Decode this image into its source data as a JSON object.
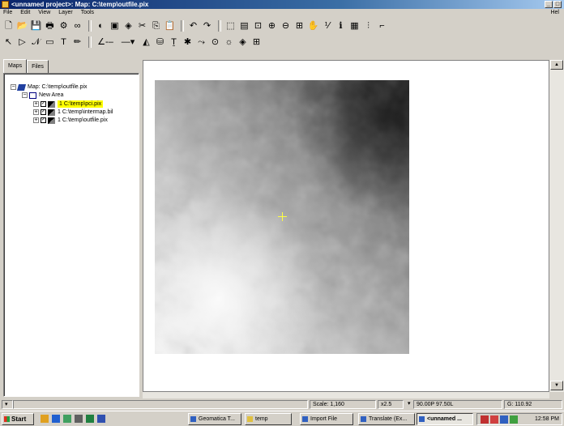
{
  "window": {
    "title": "<unnamed project>: Map: C:\\temp\\outfile.pix",
    "minimize_label": "_",
    "maximize_label": "□"
  },
  "menu": {
    "items": [
      "File",
      "Edit",
      "View",
      "Layer",
      "Tools"
    ],
    "help_label": "Hel"
  },
  "toolbar_row1": [
    "new-file",
    "open-folder",
    "save",
    "print",
    "layer-tool",
    "binoculars",
    "erase",
    "box",
    "layers",
    "cut",
    "copy",
    "paste",
    "undo",
    "redo",
    "select-rect",
    "image-window",
    "zoom-window",
    "zoom-in",
    "zoom-out",
    "zoom-fit",
    "pan",
    "measure",
    "info",
    "table",
    "histogram",
    "panel"
  ],
  "toolbar_row2": [
    "pointer",
    "select-node",
    "polyline",
    "rectangle",
    "text",
    "pencil",
    "line-style",
    "line-weight",
    "fill-color",
    "fill-pattern",
    "text-color",
    "symbol",
    "vector-edit",
    "node-tool",
    "brightness",
    "layers-toggle",
    "grid"
  ],
  "left_panel": {
    "tabs": [
      "Maps",
      "Files"
    ],
    "tree": {
      "map_label": "Map: C:\\temp\\outfile.pix",
      "area_label": "New Area",
      "layers": [
        {
          "label": "1 C:\\temp\\pci.pix",
          "selected": true
        },
        {
          "label": "1 C:\\temp\\intermap.bil",
          "selected": false
        },
        {
          "label": "1 C:\\temp\\outfile.pix",
          "selected": false
        }
      ]
    }
  },
  "status": {
    "scale": "Scale: 1,160",
    "zoom": "x2.5",
    "coords": "90.00P 97.50L",
    "value": "G: 110.92"
  },
  "taskbar": {
    "start_label": "Start",
    "tasks": [
      "Geomatica T...",
      "temp",
      "Import File",
      "Translate (Ex...",
      "<unnamed ..."
    ],
    "active_task_index": 4,
    "clock": "12:58 PM"
  },
  "colors": {
    "title_start": "#0a246a",
    "title_end": "#a6caf0",
    "selection": "#ffff00",
    "crosshair": "#ffff40"
  }
}
